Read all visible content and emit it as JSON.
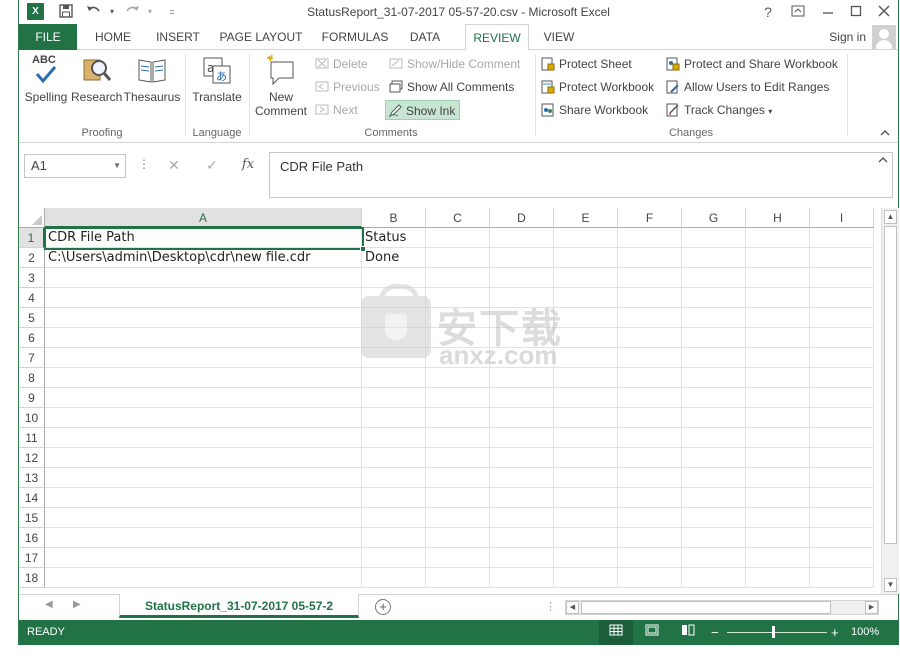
{
  "window": {
    "title": "StatusReport_31-07-2017 05-57-20.csv - Microsoft Excel",
    "app_icon": "excel-icon",
    "help": "?",
    "controls": [
      "ribbon-display-icon",
      "minimize-icon",
      "maximize-icon",
      "close-icon"
    ]
  },
  "quick_access": [
    "save-icon",
    "undo-icon",
    "redo-icon",
    "customize-icon"
  ],
  "tabs": {
    "file": "FILE",
    "items": [
      "HOME",
      "INSERT",
      "PAGE LAYOUT",
      "FORMULAS",
      "DATA",
      "REVIEW",
      "VIEW"
    ],
    "active": "REVIEW",
    "sign_in": "Sign in"
  },
  "ribbon": {
    "proofing": {
      "label": "Proofing",
      "spelling": "Spelling",
      "spelling_badge": "ABC",
      "research": "Research",
      "thesaurus": "Thesaurus"
    },
    "language": {
      "label": "Language",
      "translate": "Translate"
    },
    "comments": {
      "label": "Comments",
      "new_comment_line1": "New",
      "new_comment_line2": "Comment",
      "delete": "Delete",
      "previous": "Previous",
      "next": "Next",
      "show_hide": "Show/Hide Comment",
      "show_all": "Show All Comments",
      "show_ink": "Show Ink"
    },
    "changes": {
      "label": "Changes",
      "protect_sheet": "Protect Sheet",
      "protect_workbook": "Protect Workbook",
      "share_workbook": "Share Workbook",
      "protect_share": "Protect and Share Workbook",
      "allow_edit": "Allow Users to Edit Ranges",
      "track_changes": "Track Changes"
    }
  },
  "formula_bar": {
    "name_box": "A1",
    "fx": "fx",
    "content": "CDR File Path"
  },
  "grid": {
    "columns": [
      "A",
      "B",
      "C",
      "D",
      "E",
      "F",
      "G",
      "H",
      "I"
    ],
    "rows": [
      "1",
      "2",
      "3",
      "4",
      "5",
      "6",
      "7",
      "8",
      "9",
      "10",
      "11",
      "12",
      "13",
      "14",
      "15",
      "16",
      "17",
      "18"
    ],
    "cells": {
      "A1": "CDR File Path",
      "B1": "Status",
      "A2": "C:\\Users\\admin\\Desktop\\cdr\\new file.cdr",
      "B2": "Done"
    },
    "selected": "A1"
  },
  "watermark": {
    "cn": "安下载",
    "en": "anxz.com"
  },
  "sheets": {
    "active": "StatusReport_31-07-2017 05-57-2"
  },
  "status": {
    "ready": "READY",
    "zoom": "100%",
    "zoom_out": "−",
    "zoom_in": "+"
  }
}
